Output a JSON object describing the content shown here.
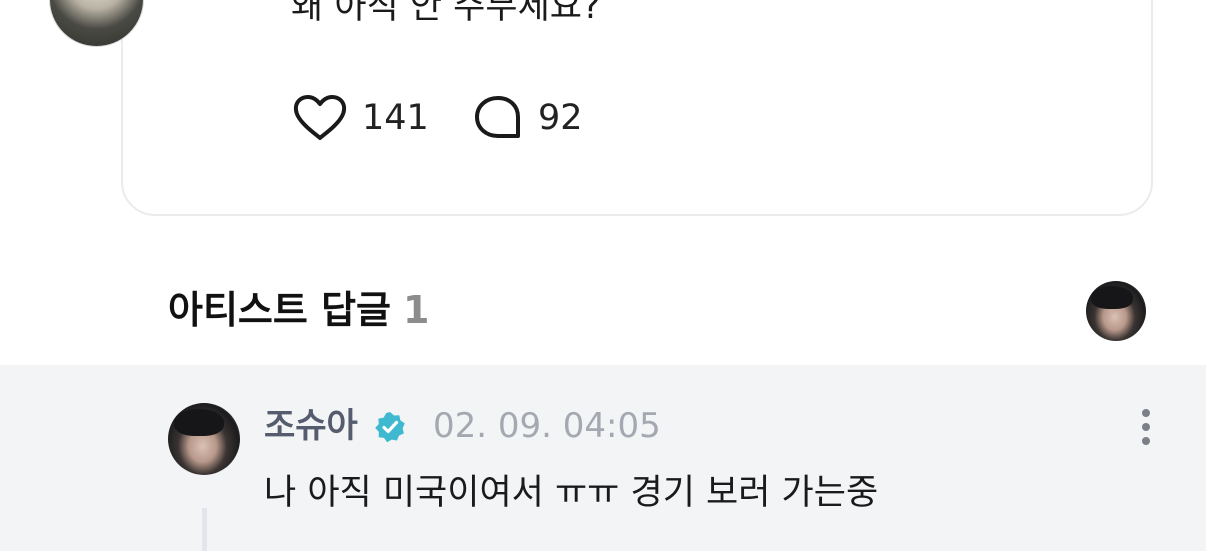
{
  "post": {
    "text": "왜 아직 안 주무세요?",
    "like_count": "141",
    "comment_count": "92",
    "icons": {
      "like": "heart-icon",
      "comment": "speech-bubble-icon"
    }
  },
  "artist_replies": {
    "title": "아티스트 답글",
    "count": "1"
  },
  "reply": {
    "author": "조슈아",
    "timestamp": "02. 09. 04:05",
    "text": "나 아직 미국이여서 ㅠㅠ 경기 보러 가는중",
    "icons": {
      "verified": "verified-badge-icon",
      "more": "more-vertical-icon"
    }
  },
  "colors": {
    "accent_verified": "#3fb9cf",
    "reply_background": "#f3f4f6",
    "author_name": "#555c6e",
    "timestamp": "#a4a8b0",
    "count_muted": "#8c8c8c"
  }
}
